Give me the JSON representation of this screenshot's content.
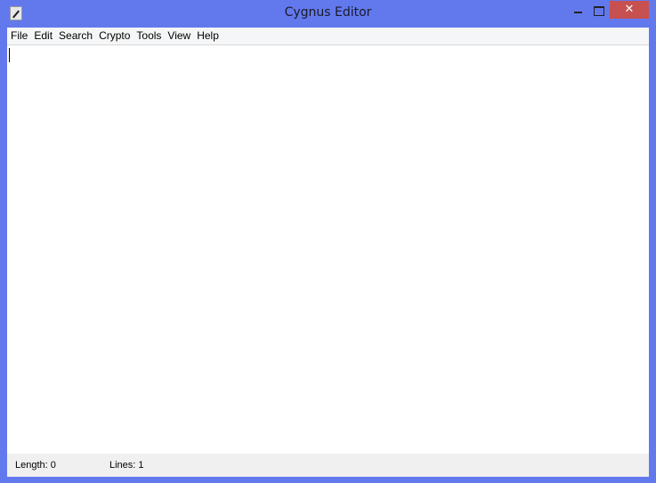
{
  "window": {
    "title": "Cygnus Editor",
    "close_glyph": "✕"
  },
  "menu": [
    "File",
    "Edit",
    "Search",
    "Crypto",
    "Tools",
    "View",
    "Help"
  ],
  "status": {
    "length": "Length: 0",
    "lines": "Lines: 1"
  }
}
